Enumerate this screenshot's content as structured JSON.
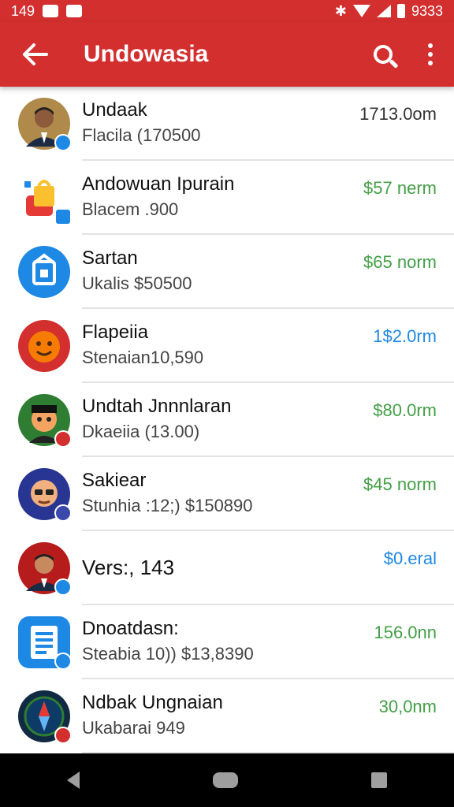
{
  "status_bar": {
    "time": "149",
    "right_text": "9333"
  },
  "app_bar": {
    "title": "Undowasia",
    "back_icon": "arrow-left-icon",
    "search_icon": "search-icon",
    "more_icon": "more-vert-icon"
  },
  "colors": {
    "primary": "#d32f2f",
    "green": "#43a047",
    "blue": "#1e88e5",
    "dark": "#333333"
  },
  "items": [
    {
      "name": "Undaak",
      "sub": "Flacila (170500",
      "amount": "1713.0om",
      "amount_color": "#333333",
      "avatar": "person-avatar"
    },
    {
      "name": "Andowuan Ipurain",
      "sub": "Blacem .900",
      "amount": "$57 nerm",
      "amount_color": "#43a047",
      "avatar": "shopping-bag-avatar"
    },
    {
      "name": "Sartan",
      "sub": "Ukalis $50500",
      "amount": "$65 norm",
      "amount_color": "#43a047",
      "avatar": "store-avatar"
    },
    {
      "name": "Flapeiia",
      "sub": "Stenaian10,590",
      "amount": "1$2.0rm",
      "amount_color": "#1e88e5",
      "avatar": "smile-avatar"
    },
    {
      "name": "Undtah Jnnnlaran",
      "sub": "Dkaeiia (13.00)",
      "amount": "$80.0rm",
      "amount_color": "#43a047",
      "avatar": "cartoon-avatar"
    },
    {
      "name": "Sakiear",
      "sub": "Stunhia :12;) $150890",
      "amount": "$45 norm",
      "amount_color": "#43a047",
      "avatar": "glasses-avatar"
    },
    {
      "name": "Vers:, 143",
      "sub": "",
      "amount": "$0.eral",
      "amount_color": "#1e88e5",
      "avatar": "person-red-avatar"
    },
    {
      "name": "Dnoatdasn:",
      "sub": "Steabia 10)) $13,8390",
      "amount": "156.0nn",
      "amount_color": "#43a047",
      "avatar": "document-avatar"
    },
    {
      "name": "Ndbak Ungnaian",
      "sub": "Ukabarai 949",
      "amount": "30,0nm",
      "amount_color": "#43a047",
      "avatar": "compass-avatar"
    }
  ]
}
